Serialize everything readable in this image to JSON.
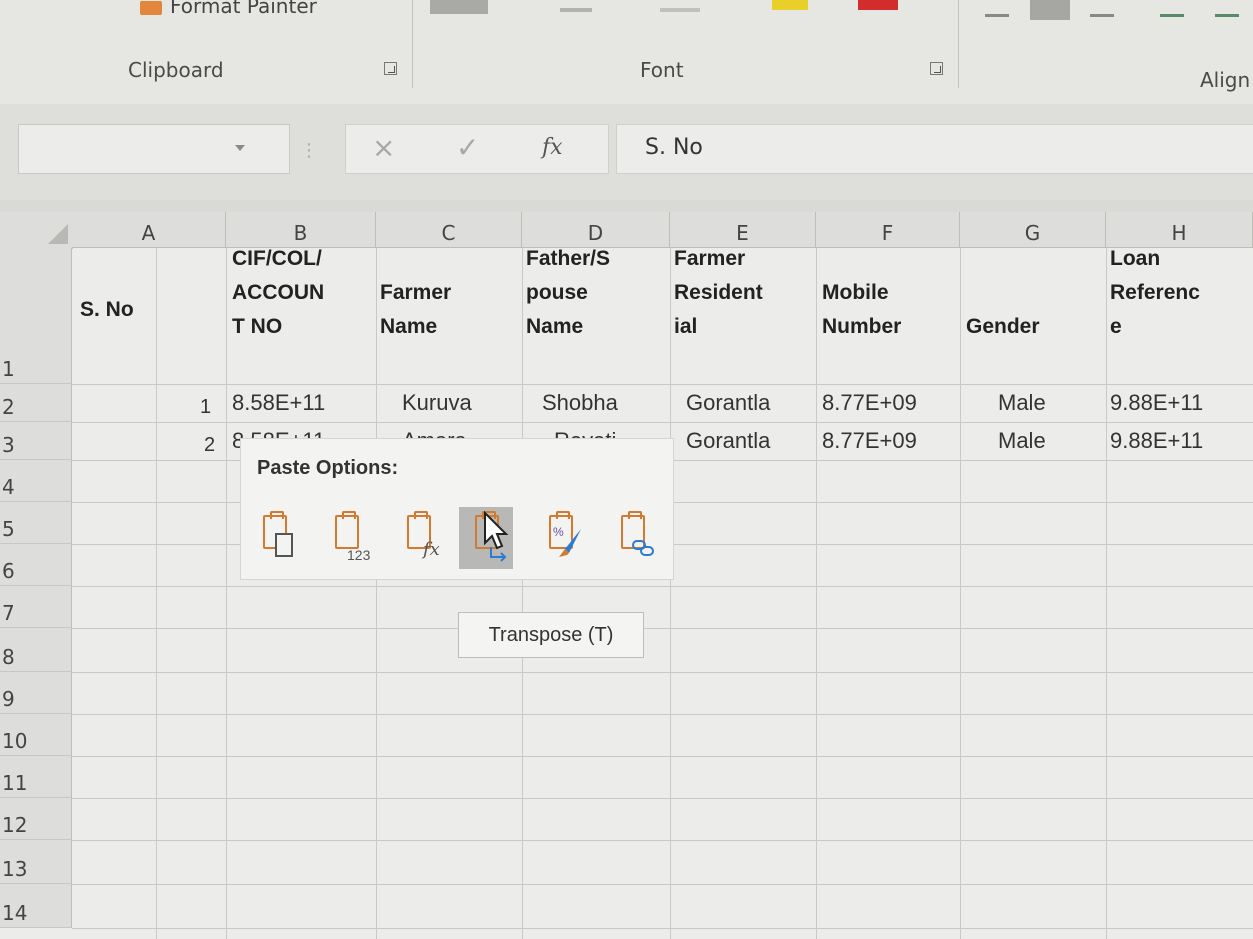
{
  "ribbon": {
    "format_painter": "Format Painter",
    "groups": [
      "Clipboard",
      "Font",
      "Align"
    ]
  },
  "formula_bar": {
    "name_box": "",
    "cancel_icon": "×",
    "enter_icon": "✓",
    "fx_label": "fx",
    "content": "S. No"
  },
  "columns": [
    "A",
    "B",
    "C",
    "D",
    "E",
    "F",
    "G",
    "H"
  ],
  "rows": [
    "1",
    "2",
    "3",
    "4",
    "5",
    "6",
    "7",
    "8",
    "9",
    "10",
    "11",
    "12",
    "13",
    "14"
  ],
  "header_row": {
    "a": [
      "S. No"
    ],
    "b": [
      "CIF/COL/",
      "ACCOUN",
      "T NO"
    ],
    "c": [
      "Farmer",
      "Name"
    ],
    "d": [
      "Father/S",
      "pouse",
      "Name"
    ],
    "e": [
      "Farmer",
      "Resident",
      "ial"
    ],
    "f": [
      "Mobile",
      "Number"
    ],
    "g": [
      "Gender"
    ],
    "h": [
      "Loan",
      "Referenc",
      "e"
    ]
  },
  "data_rows": [
    {
      "sno": "1",
      "account": "8.58E+11",
      "farmer": "Kuruva",
      "spouse": "Shobha",
      "residential": "Gorantla",
      "mobile": "8.77E+09",
      "gender": "Male",
      "loan": "9.88E+11"
    },
    {
      "sno": "2",
      "account": "8.58E+11",
      "farmer": "Amara",
      "spouse": "Revati",
      "residential": "Gorantla",
      "mobile": "8.77E+09",
      "gender": "Male",
      "loan": "9.88E+11"
    }
  ],
  "paste_options": {
    "title": "Paste Options:",
    "items": [
      {
        "name": "paste",
        "tag": ""
      },
      {
        "name": "values",
        "tag": "123"
      },
      {
        "name": "formulas",
        "tag": "fx"
      },
      {
        "name": "transpose",
        "tag": ""
      },
      {
        "name": "formatting",
        "tag": "%"
      },
      {
        "name": "paste-link",
        "tag": ""
      }
    ],
    "tooltip": "Transpose (T)"
  },
  "colors": {
    "accent": "#d17a30",
    "grid": "#c9cac6"
  }
}
